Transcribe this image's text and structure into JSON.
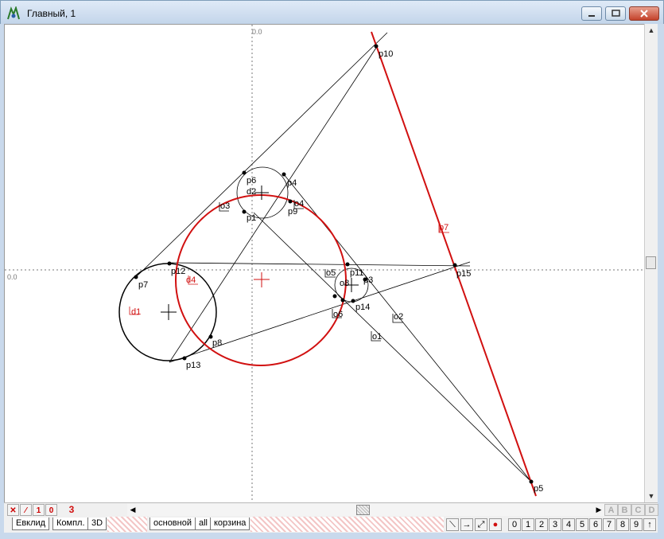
{
  "window": {
    "title": "Главный, 1"
  },
  "canvas": {
    "axis_labels": {
      "x_origin": "0.0",
      "y_origin": "0.0"
    },
    "point_labels": [
      "p1",
      "p3",
      "p4",
      "p5",
      "p6",
      "p7",
      "p8",
      "p9",
      "p10",
      "p11",
      "p12",
      "p13",
      "p14",
      "p15"
    ],
    "line_labels": [
      "o1",
      "o2",
      "o3",
      "o4",
      "o5",
      "o6",
      "o8",
      "p7"
    ],
    "circle_labels": [
      "d1",
      "d2",
      "d4"
    ]
  },
  "statusbar": {
    "buttons": [
      "✕",
      "⁄",
      "1",
      "0"
    ],
    "counter": "3",
    "letters": [
      "A",
      "B",
      "C",
      "D"
    ]
  },
  "tabs": {
    "left": [
      "Евклид",
      "Компл.",
      "3D"
    ],
    "layers": [
      "основной",
      "all",
      "корзина"
    ]
  },
  "toolbar": {
    "numbers": [
      "0",
      "1",
      "2",
      "3",
      "4",
      "5",
      "6",
      "7",
      "8",
      "9",
      "↑"
    ]
  },
  "colors": {
    "construction": "#000000",
    "highlight": "#d11010",
    "axes": "#777777"
  }
}
